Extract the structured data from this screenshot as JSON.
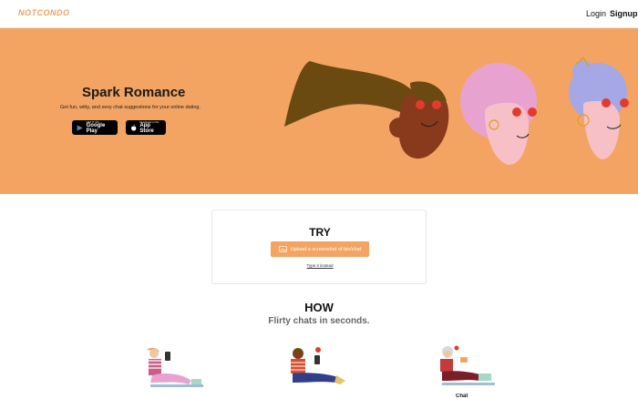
{
  "header": {
    "logo_text": "NOTCONDO",
    "login_label": "Login",
    "signup_label": "Signup"
  },
  "hero": {
    "title": "Spark Romance",
    "subtitle": "Get fun, witty, and sexy chat suggestions for your online dating.",
    "google_play": {
      "small": "GET IT ON",
      "big": "Google Play"
    },
    "app_store": {
      "small": "Download on the",
      "big": "App Store"
    },
    "background_color": "#f3a462"
  },
  "try": {
    "title": "TRY",
    "upload_label": "Upload a screenshot of bio/chat",
    "type_link": "Type it instead"
  },
  "how": {
    "title": "HOW",
    "subtitle": "Flirty chats in seconds.",
    "step_label_partial": "Chat"
  },
  "icons": {
    "google_play": "google-play-icon",
    "app_store": "apple-icon",
    "upload": "image-upload-icon"
  }
}
